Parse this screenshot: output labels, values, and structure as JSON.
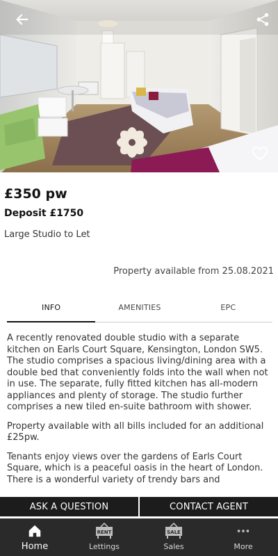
{
  "listing": {
    "price": "£350 pw",
    "deposit": "Deposit £1750",
    "title": "Large Studio to Let",
    "availability": "Property available from 25.08.2021"
  },
  "tabs": [
    {
      "label": "INFO",
      "active": true
    },
    {
      "label": "AMENITIES",
      "active": false
    },
    {
      "label": "EPC",
      "active": false
    }
  ],
  "description": {
    "paragraphs": [
      "A recently renovated double studio with a separate kitchen on Earls Court Square, Kensington, London SW5. The studio comprises a spacious living/dining area with a double bed that conveniently folds into the wall when not in use. The separate, fully fitted kitchen has all-modern appliances and plenty of storage. The studio further comprises a new tiled en-suite bathroom with shower.",
      "Property available with all bills included for an additional £25pw.",
      "Tenants enjoy views over the gardens of Earls Court Square, which is a peaceful oasis in the heart of London. There is a wonderful variety of trendy bars and"
    ]
  },
  "actions": {
    "ask": "ASK A QUESTION",
    "contact": "CONTACT AGENT"
  },
  "nav": {
    "home": "Home",
    "lettings": "Lettings",
    "sales": "Sales",
    "more": "More",
    "lettings_sign": "RENT",
    "sales_sign": "SALE"
  },
  "icons": {
    "back": "arrow-left-icon",
    "share": "share-icon",
    "favourite": "heart-outline-icon",
    "home": "home-icon",
    "lettings": "rent-sign-icon",
    "sales": "sale-sign-icon",
    "more": "more-dots-icon"
  },
  "colors": {
    "action_bg": "#1c1c1c",
    "nav_bg": "#2a2a2a",
    "active_tab": "#111111"
  }
}
